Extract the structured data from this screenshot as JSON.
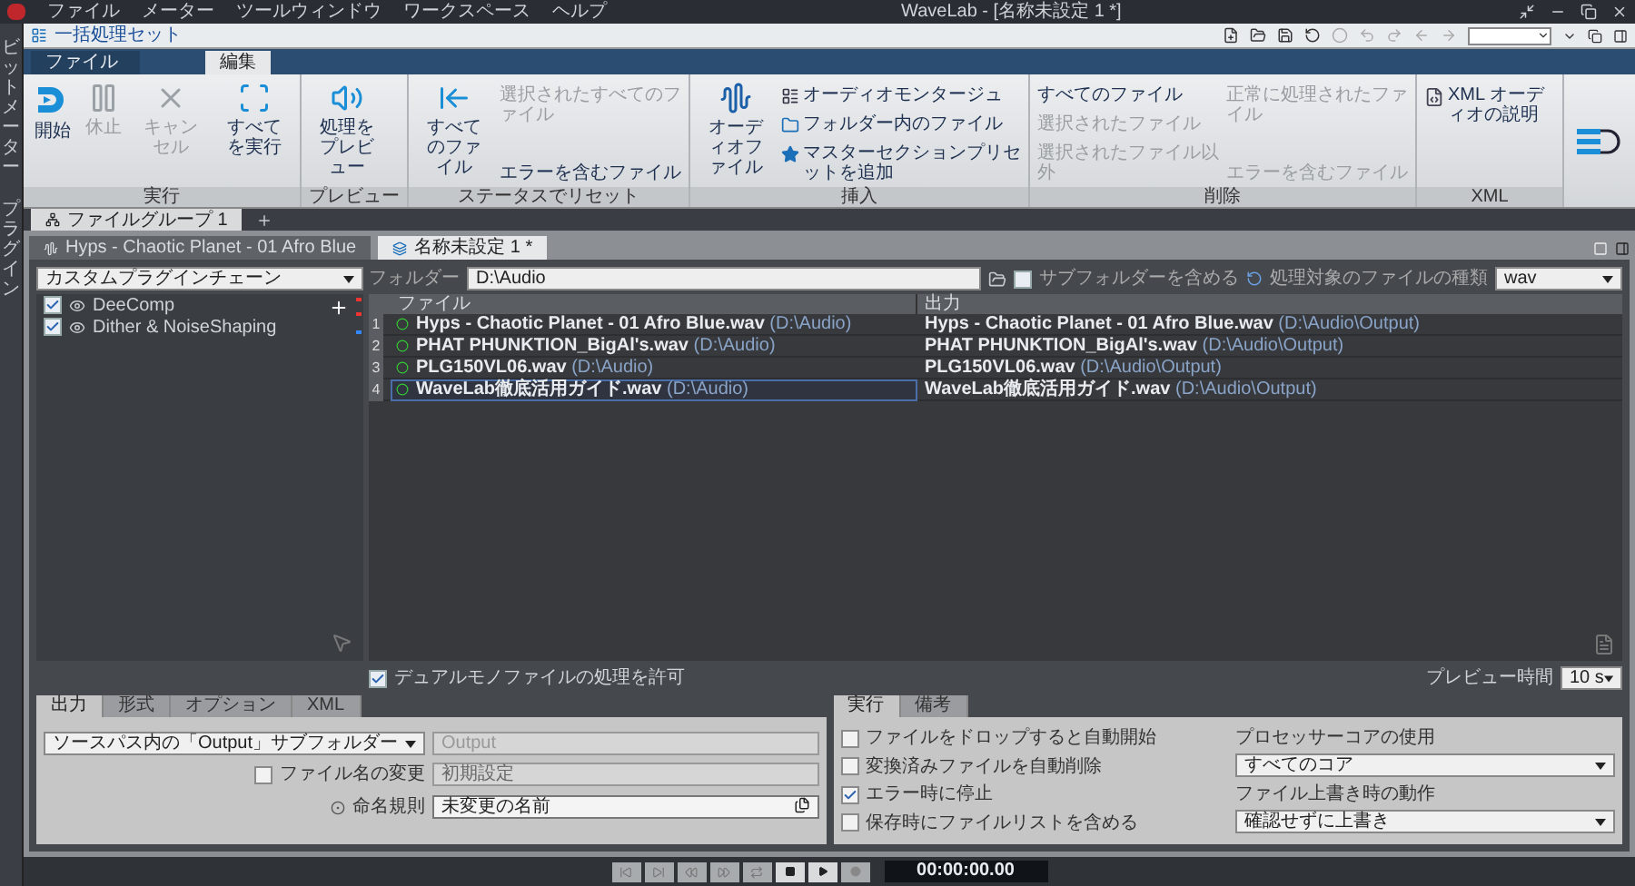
{
  "menu": [
    "ファイル",
    "メーター",
    "ツールウィンドウ",
    "ワークスペース",
    "ヘルプ"
  ],
  "window_title": "WaveLab - [名称未設定 1 *]",
  "side_strip": [
    "ビットメーター",
    "プラグイン"
  ],
  "workspace_title": "一括処理セット",
  "ribbon_tabs": [
    {
      "label": "ファイル",
      "selected": false
    },
    {
      "label": "編集",
      "selected": true
    }
  ],
  "ribbon_groups": [
    {
      "label": "実行",
      "buttons": [
        {
          "label": "開始",
          "disabled": false
        },
        {
          "label": "休止",
          "disabled": true
        },
        {
          "label": "キャンセル",
          "disabled": true
        },
        {
          "label": "すべてを実行",
          "disabled": false
        }
      ]
    },
    {
      "label": "プレビュー",
      "buttons": [
        {
          "label": "処理をプレビュー",
          "disabled": false
        }
      ]
    },
    {
      "label": "ステータスでリセット",
      "buttons": [
        {
          "label": "すべてのファイル",
          "disabled": false
        }
      ],
      "columns": [
        [
          {
            "label": "選択されたすべてのファイル",
            "disabled": true
          },
          {
            "label": "エラーを含むファイル",
            "disabled": false
          }
        ]
      ]
    },
    {
      "label": "挿入",
      "buttons": [
        {
          "label": "オーディオファイル",
          "disabled": false
        }
      ],
      "columns": [
        [
          {
            "label": "オーディオモンタージュ",
            "disabled": false
          },
          {
            "label": "フォルダー内のファイル",
            "disabled": false
          },
          {
            "label": "マスターセクションプリセットを追加",
            "disabled": false
          }
        ]
      ]
    },
    {
      "label": "削除",
      "columns": [
        [
          {
            "label": "すべてのファイル",
            "disabled": false
          },
          {
            "label": "選択されたファイル",
            "disabled": true
          },
          {
            "label": "選択されたファイル以外",
            "disabled": true
          }
        ],
        [
          {
            "label": "正常に処理されたファイル",
            "disabled": true
          },
          {
            "label": "エラーを含むファイル",
            "disabled": true
          }
        ]
      ]
    },
    {
      "label": "XML",
      "columns": [
        [
          {
            "label": "XML オーディオの説明",
            "disabled": false
          }
        ]
      ]
    }
  ],
  "file_group_tabs": [
    {
      "label": "ファイルグループ 1",
      "selected": true
    }
  ],
  "doc_tabs": [
    {
      "label": "Hyps - Chaotic Planet - 01 Afro Blue",
      "selected": false
    },
    {
      "label": "名称未設定 1 *",
      "selected": true
    }
  ],
  "plugin_chain": {
    "value": "カスタムプラグインチェーン",
    "plugins": [
      {
        "name": "DeeComp",
        "checked": true
      },
      {
        "name": "Dither & NoiseShaping",
        "checked": true
      }
    ]
  },
  "folder": {
    "label": "フォルダー",
    "value": "D:\\Audio",
    "include_subfolders": {
      "label": "サブフォルダーを含める",
      "checked": false
    },
    "file_type_label": "処理対象のファイルの種類",
    "file_type": "wav"
  },
  "table": {
    "columns": [
      "ファイル",
      "出力"
    ],
    "rows": [
      {
        "number": "1",
        "file": "**Hyps - Chaotic Planet - 01 Afro Blue.wav** (D:\\Audio)",
        "output": "**Hyps - Chaotic Planet - 01 Afro Blue.wav** (D:\\Audio\\Output)",
        "selected": false
      },
      {
        "number": "2",
        "file": "**PHAT PHUNKTION_BigAl's.wav** (D:\\Audio)",
        "output": "**PHAT PHUNKTION_BigAl's.wav** (D:\\Audio\\Output)",
        "selected": false
      },
      {
        "number": "3",
        "file": "**PLG150VL06.wav** (D:\\Audio)",
        "output": "**PLG150VL06.wav** (D:\\Audio\\Output)",
        "selected": false
      },
      {
        "number": "4",
        "file": "**WaveLab徹底活用ガイド.wav** (D:\\Audio)",
        "output": "**WaveLab徹底活用ガイド.wav** (D:\\Audio\\Output)",
        "selected": true
      }
    ]
  },
  "dual_mono": {
    "label": "デュアルモノファイルの処理を許可",
    "checked": true
  },
  "preview_time": {
    "label": "プレビュー時間",
    "value": "10 s"
  },
  "output_panel": {
    "tabs": [
      {
        "label": "出力",
        "selected": true
      },
      {
        "label": "形式",
        "selected": false
      },
      {
        "label": "オプション",
        "selected": false
      },
      {
        "label": "XML",
        "selected": false
      }
    ],
    "destination": "ソースパス内の「Output」サブフォルダー",
    "subfolder": "Output",
    "rename": {
      "label": "ファイル名の変更",
      "checked": false
    },
    "rename_preset": "初期設定",
    "naming_label": "命名規則",
    "naming_value": "未変更の名前"
  },
  "run_panel": {
    "tabs": [
      {
        "label": "実行",
        "selected": true
      },
      {
        "label": "備考",
        "selected": false
      }
    ],
    "options": [
      {
        "label": "ファイルをドロップすると自動開始",
        "checked": false
      },
      {
        "label": "変換済みファイルを自動削除",
        "checked": false
      },
      {
        "label": "エラー時に停止",
        "checked": true
      },
      {
        "label": "保存時にファイルリストを含める",
        "checked": false
      }
    ],
    "cores_label": "プロセッサーコアの使用",
    "cores": "すべてのコア",
    "overwrite_label": "ファイル上書き時の動作",
    "overwrite": "確認せずに上書き"
  },
  "transport": {
    "time": "00:00:00.00"
  }
}
